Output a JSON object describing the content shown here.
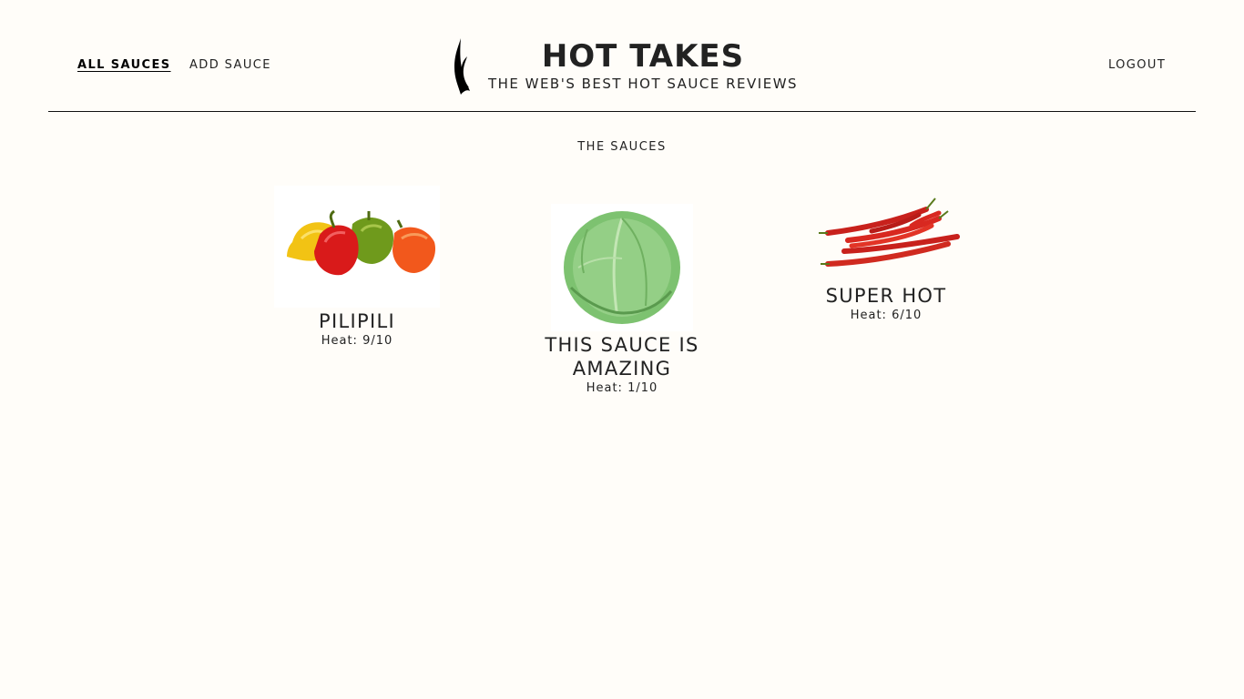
{
  "header": {
    "nav": {
      "all_sauces": "ALL SAUCES",
      "add_sauce": "ADD SAUCE",
      "logout": "LOGOUT"
    },
    "brand": {
      "title": "HOT TAKES",
      "subtitle": "THE WEB'S BEST HOT SAUCE REVIEWS",
      "logo_icon": "flame-icon"
    }
  },
  "main": {
    "section_title": "THE SAUCES",
    "heat_label": "Heat:",
    "sauces": [
      {
        "name": "PILIPILI",
        "heat": "9/10",
        "image": "peppers-image"
      },
      {
        "name": "THIS SAUCE IS AMAZING",
        "heat": "1/10",
        "image": "cabbage-image"
      },
      {
        "name": "SUPER HOT",
        "heat": "6/10",
        "image": "chili-image"
      }
    ]
  },
  "colors": {
    "background": "#fffdf9",
    "text": "#222222",
    "divider": "#111111"
  }
}
